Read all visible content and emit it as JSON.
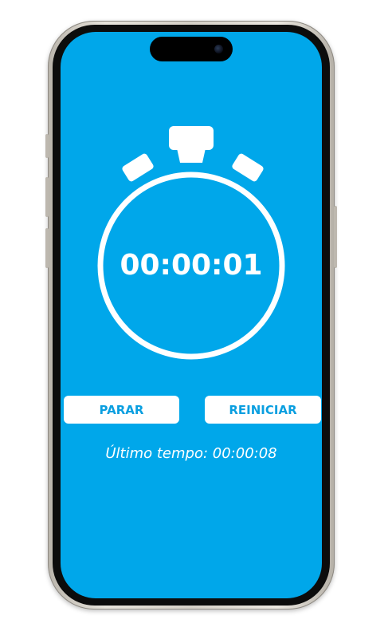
{
  "stopwatch": {
    "time": "00:00:01"
  },
  "controls": {
    "stop_label": "PARAR",
    "reset_label": "REINICIAR"
  },
  "last_time": {
    "text": "Último tempo: 00:00:08"
  },
  "colors": {
    "background": "#00a7ea",
    "accent": "#ffffff",
    "button_text": "#0a9fe0"
  },
  "icons": {
    "stopwatch": "stopwatch-icon"
  }
}
